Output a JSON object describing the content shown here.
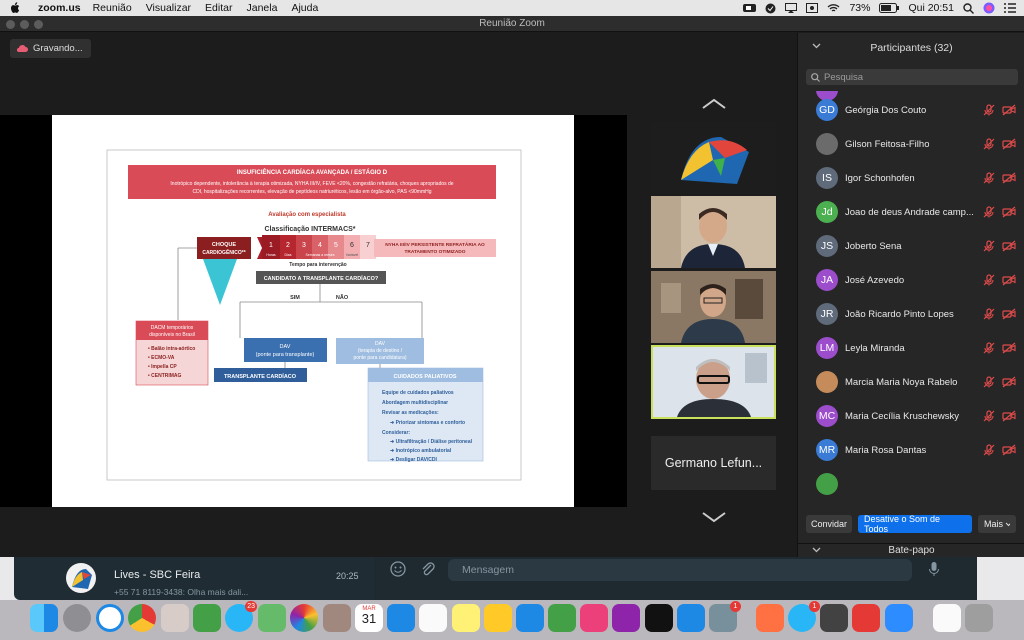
{
  "menubar": {
    "app_name": "zoom.us",
    "items": [
      "Reunião",
      "Visualizar",
      "Editar",
      "Janela",
      "Ajuda"
    ],
    "battery": "73%",
    "clock": "Qui 20:51"
  },
  "window": {
    "title": "Reunião Zoom",
    "recording_label": "Gravando..."
  },
  "slide": {
    "header_title": "INSUFICIÊNCIA CARDÍACA AVANÇADA / ESTÁGIO D",
    "header_line1": "Inotrópico dependente, intolerância à terapia otimizada, NYHA III/IV, FEVE <20%, congestão refratária, choques apropriados de",
    "header_line2": "CDI, hospitalizações recorrentes, elevação de peptídeos natriuréticos, lesão em órgão-alvo, PAS <90mmHg",
    "avaliacao": "Avaliação com especialista",
    "classificacao": "Classificação INTERMACS*",
    "choque": [
      "CHOQUE",
      "CARDIOGÊNICO**"
    ],
    "intermacs_levels": [
      "1",
      "2",
      "3",
      "4",
      "5",
      "6",
      "7"
    ],
    "timing_labels": [
      "Horas",
      "Dias",
      "Semanas a meses",
      "Variável"
    ],
    "tempo": "Tempo para intervenção",
    "nyha_box": [
      "NYHA III/IV PERSISTENTE REFRATÁRIA AO",
      "TRATAMENTO OTIMIZADO"
    ],
    "candidato": "CANDIDATO A TRANSPLANTE CARDÍACO?",
    "sim": "SIM",
    "nao": "NÃO",
    "dac_title": [
      "DACM temporários",
      "disponíveis no Brasil"
    ],
    "dac_items": [
      "Balão intra-aórtico",
      "ECMO-VA",
      "Impella CP",
      "CENTRIMAG"
    ],
    "dav_left": [
      "DAV",
      "(ponte para transplante)"
    ],
    "dav_right": [
      "DAV",
      "(terapia de destino /",
      "ponte para candidatura)"
    ],
    "transplante": "TRANSPLANTE CARDÍACO",
    "paliativos_title": "CUIDADOS PALIATIVOS",
    "paliativos_items": [
      "Equipe de cuidados paliativos",
      "Abordagem multidisciplinar",
      "Revisar as medicações:",
      "Priorizar sintomas e conforto",
      "Considerar:",
      "Ultrafiltração / Diálise peritoneal",
      "Inotrópico ambulatorial",
      "Desligar DAV/CDI"
    ]
  },
  "video": {
    "active_speaker_name": "Germano Lefun..."
  },
  "participants": {
    "header": "Participantes (32)",
    "search_placeholder": "Pesquisa",
    "list": [
      {
        "initials": "GD",
        "name": "Geórgia Dos Couto",
        "color": "#3a7bd5"
      },
      {
        "initials": "",
        "name": "Gilson Feitosa-Filho",
        "color": "#6b6b6b"
      },
      {
        "initials": "IS",
        "name": "Igor Schonhofen",
        "color": "#5f6b7a"
      },
      {
        "initials": "Jd",
        "name": "Joao de deus Andrade camp...",
        "color": "#4caf50"
      },
      {
        "initials": "JS",
        "name": "Joberto Sena",
        "color": "#5f6b7a"
      },
      {
        "initials": "JA",
        "name": "José Azevedo",
        "color": "#9c4dcc"
      },
      {
        "initials": "JR",
        "name": "João Ricardo Pinto Lopes",
        "color": "#5f6b7a"
      },
      {
        "initials": "LM",
        "name": "Leyla Miranda",
        "color": "#9c4dcc"
      },
      {
        "initials": "",
        "name": "Marcia Maria Noya Rabelo",
        "color": "#c58b5a"
      },
      {
        "initials": "MC",
        "name": "Maria Cecília Kruschewsky",
        "color": "#9c4dcc"
      },
      {
        "initials": "MR",
        "name": "Maria Rosa Dantas",
        "color": "#3a7bd5"
      }
    ],
    "invite_label": "Convidar",
    "mute_all_label": "Desative o Som de Todos",
    "more_label": "Mais"
  },
  "chat": {
    "header": "Bate-papo"
  },
  "background_app": {
    "chat_name": "Lives - SBC Feira",
    "time": "20:25",
    "preview": "+55 71 8119-3438: Olha mais dali...",
    "message_placeholder": "Mensagem"
  },
  "dock": {
    "calendar_month": "MAR",
    "calendar_day": "31",
    "mail_badge": "23",
    "settings_badge": "1",
    "whatsapp_badge": "1"
  }
}
